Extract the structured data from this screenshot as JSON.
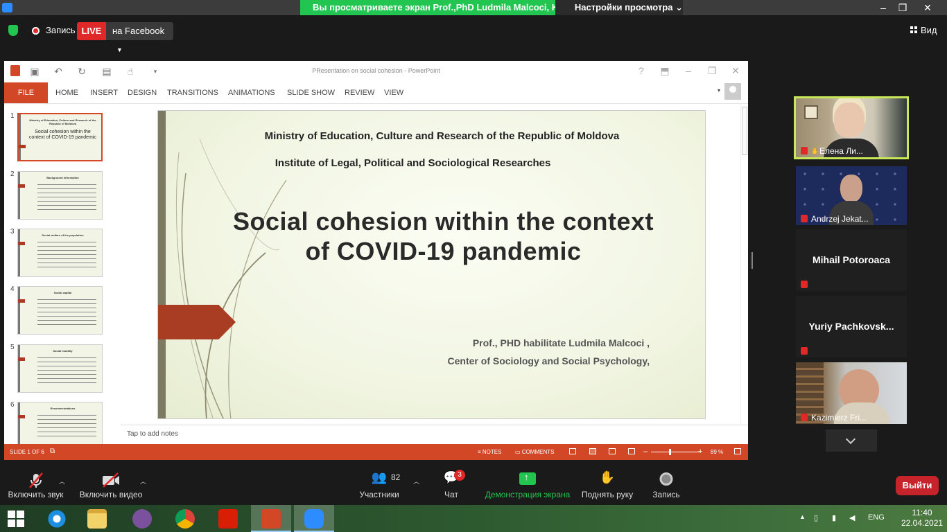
{
  "zoom": {
    "share_banner": "Вы просматриваете экран Prof.,PhD  Ludmila Malcoci, Key...",
    "view_settings": "Настройки просмотра",
    "record_label": "Запись",
    "live_badge": "LIVE",
    "facebook_label": "на Facebook",
    "view_label": "Вид"
  },
  "ppt": {
    "window_title": "PResentation on social cohesion - PowerPoint",
    "tabs": [
      "FILE",
      "HOME",
      "INSERT",
      "DESIGN",
      "TRANSITIONS",
      "ANIMATIONS",
      "SLIDE SHOW",
      "REVIEW",
      "VIEW"
    ],
    "thumbs": [
      {
        "num": "1",
        "title": "Ministry of Education, Culture and Research of the Republic of Moldova",
        "big": "Social cohesion within the context of COVID-19 pandemic"
      },
      {
        "num": "2",
        "title": "Background information",
        "big": ""
      },
      {
        "num": "3",
        "title": "Social welfare of the population",
        "big": ""
      },
      {
        "num": "4",
        "title": "Social capital",
        "big": ""
      },
      {
        "num": "5",
        "title": "Social mobility",
        "big": ""
      },
      {
        "num": "6",
        "title": "Recommendations",
        "big": ""
      }
    ],
    "slide": {
      "ministry": "Ministry of Education, Culture and Research of the Republic of Moldova",
      "institute": "Institute of Legal, Political and Sociological Researches",
      "title_line1": "Social cohesion within the context",
      "title_line2": "of COVID-19 pandemic",
      "author_line1": "Prof., PHD habilitate Ludmila Malcoci ,",
      "author_line2": "Center of Sociology and Social Psychology,"
    },
    "notes_placeholder": "Tap to add notes",
    "status": {
      "slide_counter": "SLIDE 1 OF 6",
      "notes": "NOTES",
      "comments": "COMMENTS",
      "zoom": "89 %"
    }
  },
  "participants": [
    {
      "name": "Елена Ли..."
    },
    {
      "name": "Andrzej Jekat..."
    },
    {
      "name": "Mihail Potoroaca"
    },
    {
      "name": "Yuriy  Pachkovsk..."
    },
    {
      "name": "Kazimierz Fri..."
    }
  ],
  "toolbar": {
    "unmute": "Включить звук",
    "start_video": "Включить видео",
    "participants_count": "82",
    "participants": "Участники",
    "chat": "Чат",
    "chat_badge": "3",
    "share_screen": "Демонстрация экрана",
    "raise_hand": "Поднять руку",
    "record": "Запись",
    "leave": "Выйти"
  },
  "taskbar": {
    "language": "ENG",
    "time": "11:40",
    "date": "22.04.2021"
  },
  "colors": {
    "zoom_green": "#23c551",
    "ppt_orange": "#d24726",
    "leave_red": "#c6242a"
  }
}
